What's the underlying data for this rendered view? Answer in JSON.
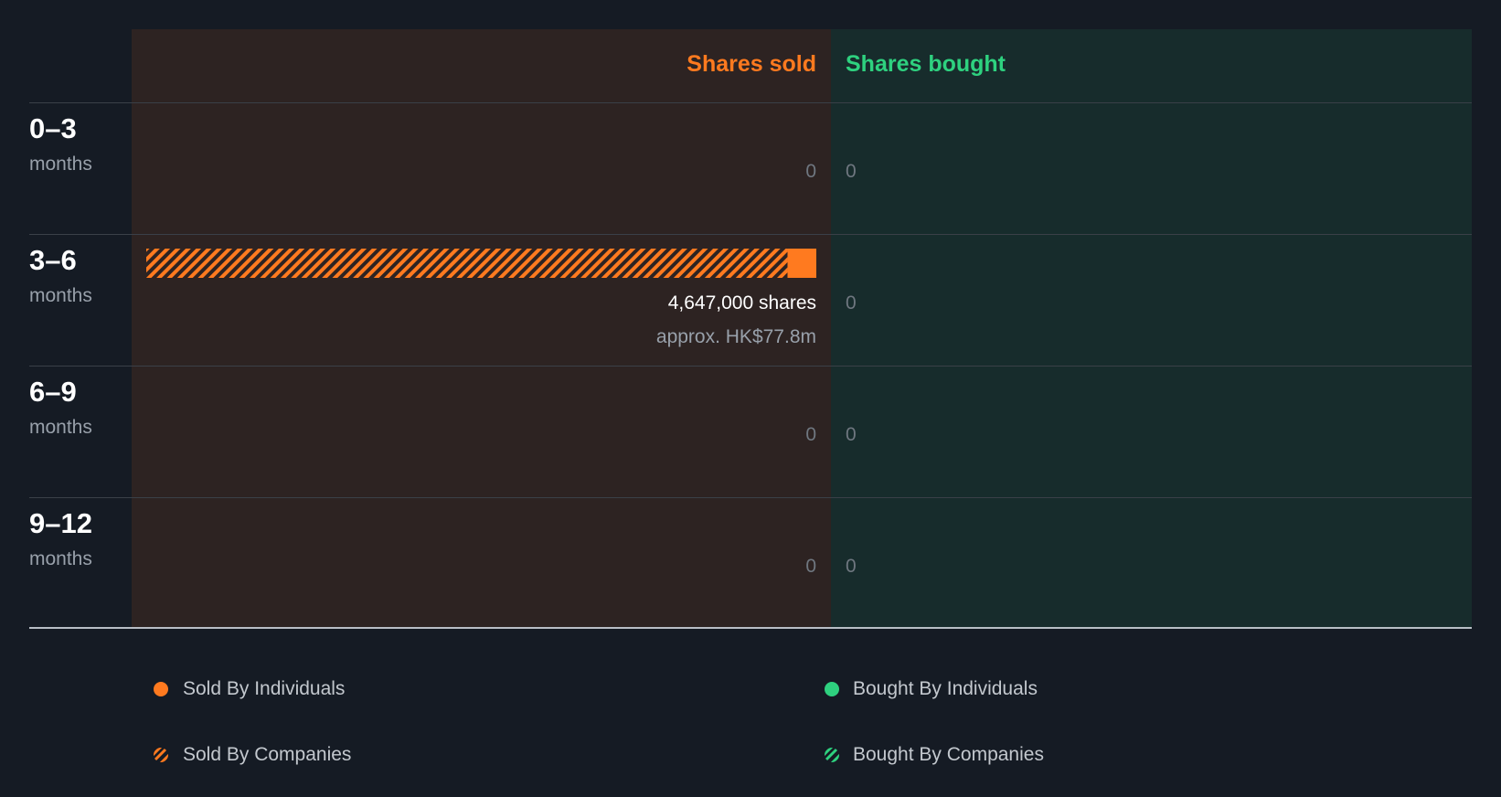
{
  "chart_data": {
    "type": "bar",
    "orientation": "horizontal-diverging",
    "headers": {
      "sold": "Shares sold",
      "bought": "Shares bought"
    },
    "categories": [
      {
        "range": "0–3",
        "unit": "months"
      },
      {
        "range": "3–6",
        "unit": "months"
      },
      {
        "range": "6–9",
        "unit": "months"
      },
      {
        "range": "9–12",
        "unit": "months"
      }
    ],
    "series": [
      {
        "name": "Sold By Individuals",
        "values": [
          0,
          200000,
          0,
          0
        ]
      },
      {
        "name": "Sold By Companies",
        "values": [
          0,
          4447000,
          0,
          0
        ]
      },
      {
        "name": "Bought By Individuals",
        "values": [
          0,
          0,
          0,
          0
        ]
      },
      {
        "name": "Bought By Companies",
        "values": [
          0,
          0,
          0,
          0
        ]
      }
    ],
    "sold_labels": [
      "0",
      "4,647,000 shares",
      "0",
      "0"
    ],
    "sold_sublabels": [
      "",
      "approx. HK$77.8m",
      "",
      ""
    ],
    "bought_labels": [
      "0",
      "0",
      "0",
      "0"
    ],
    "legend": [
      {
        "label": "Sold By Individuals",
        "style": "solid",
        "color": "#ff7a1f"
      },
      {
        "label": "Bought By Individuals",
        "style": "solid",
        "color": "#2ed17f"
      },
      {
        "label": "Sold By Companies",
        "style": "hatched",
        "color": "#ff7a1f"
      },
      {
        "label": "Bought By Companies",
        "style": "hatched",
        "color": "#2ed17f"
      }
    ],
    "colors": {
      "sold": "#ff7a1f",
      "bought": "#2ed17f",
      "background": "#151b24"
    }
  }
}
